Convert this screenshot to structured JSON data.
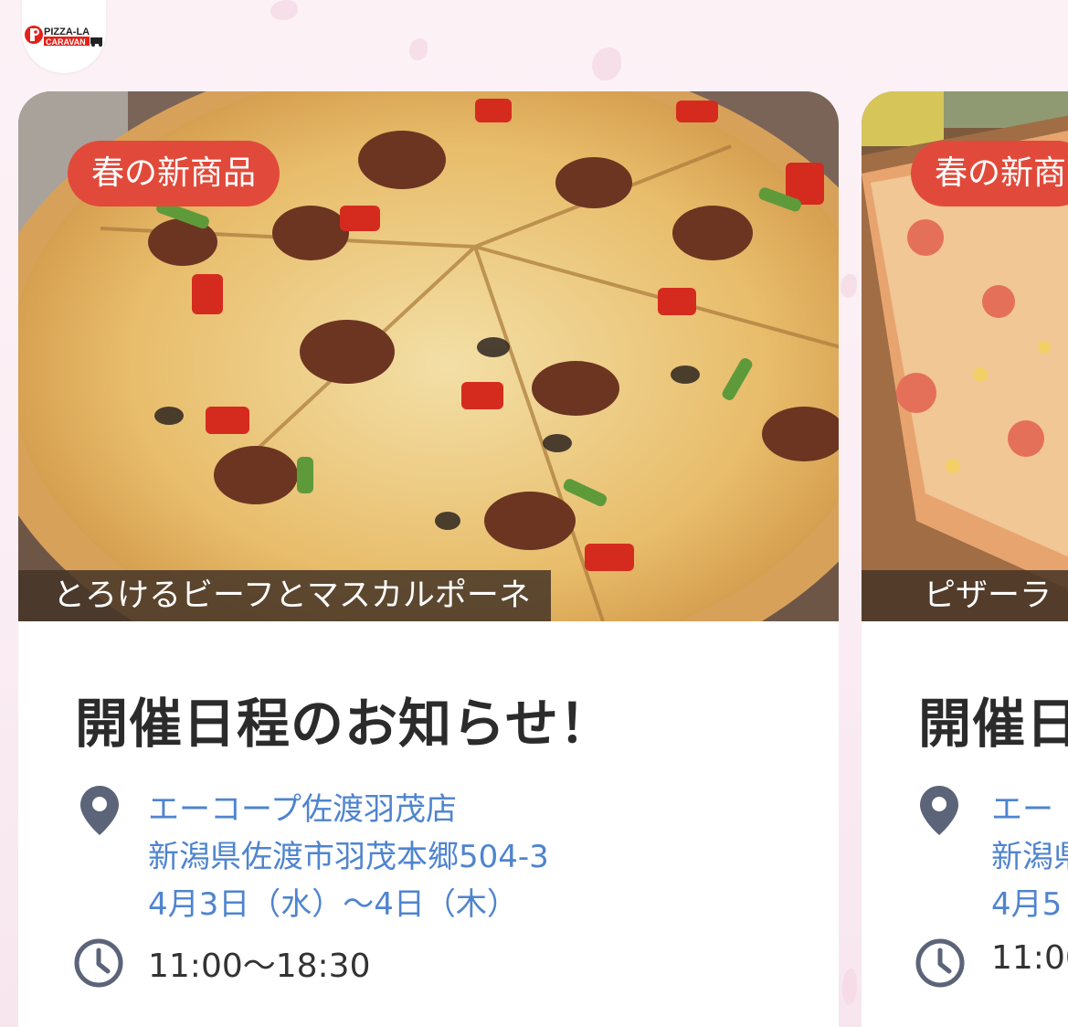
{
  "brand": {
    "logo_text_top": "PIZZA-LA",
    "logo_text_bottom": "CARAVAN"
  },
  "colors": {
    "badge": "#e14a3a",
    "link": "#4f84cf",
    "icon": "#5b6478"
  },
  "cards": [
    {
      "badge": "春の新商品",
      "caption": "とろけるビーフとマスカルポーネ",
      "title": "開催日程のお知らせ！",
      "store_name": "エーコープ佐渡羽茂店",
      "address": "新潟県佐渡市羽茂本郷504-3",
      "dates": "4月3日（水）～4日（木）",
      "hours": "11:00～18:30",
      "icons": [
        "location-pin-icon",
        "clock-icon"
      ]
    },
    {
      "badge": "春の新商",
      "caption": "ピザーラ",
      "title": "開催日",
      "store_name": "エー",
      "address": "新潟県",
      "dates": "4月5",
      "hours": "11:00",
      "icons": [
        "location-pin-icon",
        "clock-icon"
      ]
    }
  ]
}
